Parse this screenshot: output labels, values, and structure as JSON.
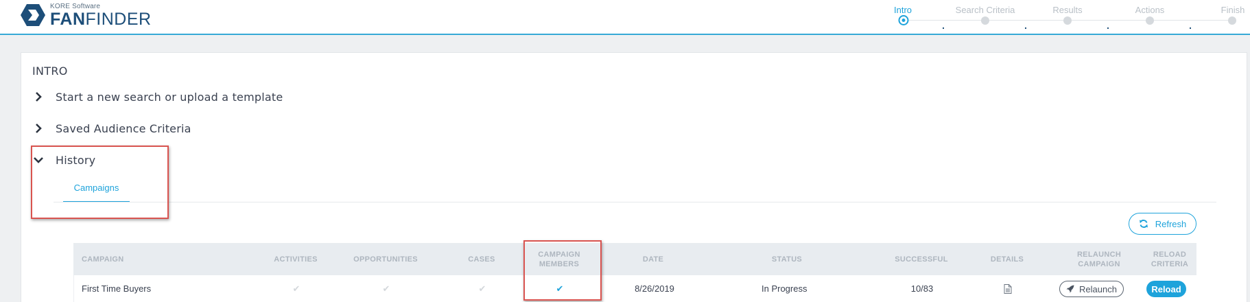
{
  "header": {
    "company": "KORE Software",
    "app_name_bold": "FAN",
    "app_name_rest": "FINDER",
    "logo_icon": "kore-diamond-icon"
  },
  "wizard": {
    "steps": [
      {
        "label": "Intro",
        "active": true
      },
      {
        "label": "Search Criteria",
        "active": false
      },
      {
        "label": "Results",
        "active": false
      },
      {
        "label": "Actions",
        "active": false
      },
      {
        "label": "Finish",
        "active": false
      }
    ]
  },
  "main": {
    "section_title": "INTRO",
    "accordion": [
      {
        "label": "Start a new search or upload a template",
        "expanded": false,
        "icon": "chevron-right-icon"
      },
      {
        "label": "Saved Audience Criteria",
        "expanded": false,
        "icon": "chevron-right-icon"
      },
      {
        "label": "History",
        "expanded": true,
        "icon": "chevron-down-icon"
      }
    ],
    "history": {
      "tabs": [
        {
          "label": "Campaigns",
          "active": true
        }
      ],
      "refresh_label": "Refresh",
      "table": {
        "headers": {
          "campaign": "CAMPAIGN",
          "activities": "ACTIVITIES",
          "opportunities": "OPPORTUNITIES",
          "cases": "CASES",
          "campaign_members_1": "CAMPAIGN",
          "campaign_members_2": "MEMBERS",
          "date": "DATE",
          "status": "STATUS",
          "successful": "SUCCESSFUL",
          "details": "DETAILS",
          "relaunch_1": "RELAUNCH",
          "relaunch_2": "CAMPAIGN",
          "reload_1": "RELOAD",
          "reload_2": "CRITERIA"
        },
        "rows": [
          {
            "campaign": "First Time Buyers",
            "activities": false,
            "opportunities": false,
            "cases": false,
            "campaign_members": true,
            "date": "8/26/2019",
            "status": "In Progress",
            "successful": "10/83",
            "details_icon": "document-icon",
            "relaunch_label": "Relaunch",
            "reload_label": "Reload"
          }
        ]
      }
    }
  },
  "colors": {
    "accent": "#1ea3db",
    "brand": "#1d4e79",
    "highlight": "#d9534f",
    "header_bg": "#e8ecf0"
  }
}
